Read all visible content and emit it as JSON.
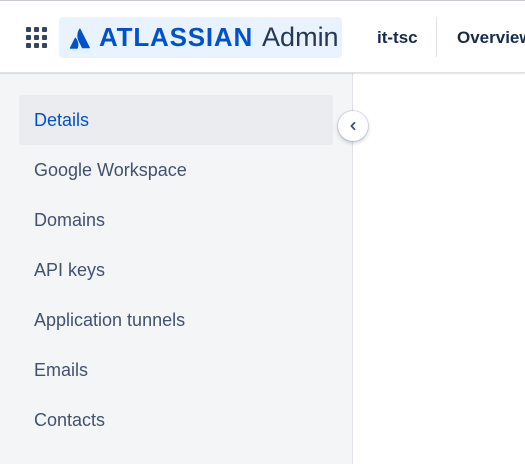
{
  "header": {
    "logo_wordmark": "ATLASSIAN",
    "logo_product": "Admin",
    "org_name": "it-tsc",
    "nav_overview": "Overview",
    "brand_color": "#0052cc",
    "app_switcher_icon": "grid-icon"
  },
  "sidebar": {
    "items": [
      {
        "label": "Details",
        "active": true
      },
      {
        "label": "Google Workspace",
        "active": false
      },
      {
        "label": "Domains",
        "active": false
      },
      {
        "label": "API keys",
        "active": false
      },
      {
        "label": "Application tunnels",
        "active": false
      },
      {
        "label": "Emails",
        "active": false
      },
      {
        "label": "Contacts",
        "active": false
      }
    ],
    "collapse_icon": "chevron-left-icon"
  }
}
